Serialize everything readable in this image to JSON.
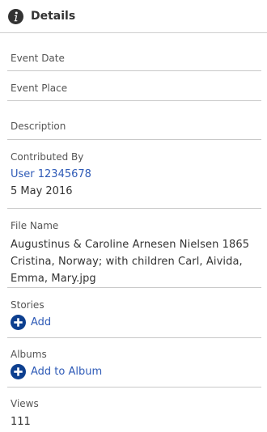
{
  "header": {
    "title": "Details"
  },
  "fields": {
    "event_date_label": "Event Date",
    "event_place_label": "Event Place",
    "description_label": "Description",
    "contributed_by_label": "Contributed By",
    "contributor": "User 12345678",
    "contributed_date": "5 May 2016",
    "file_name_label": "File Name",
    "file_name": "Augustinus & Caroline Arnesen Nielsen 1865 Cristina, Norway; with children Carl, Aivida, Emma, Mary.jpg",
    "stories_label": "Stories",
    "stories_add": "Add",
    "albums_label": "Albums",
    "albums_add": "Add to Album",
    "views_label": "Views",
    "views_count": "111"
  },
  "colors": {
    "link": "#2f5bb7",
    "icon_fill": "#333333",
    "add_icon": "#0d3f8f"
  },
  "icons": {
    "header": "info-icon",
    "add": "plus-circle-icon"
  }
}
